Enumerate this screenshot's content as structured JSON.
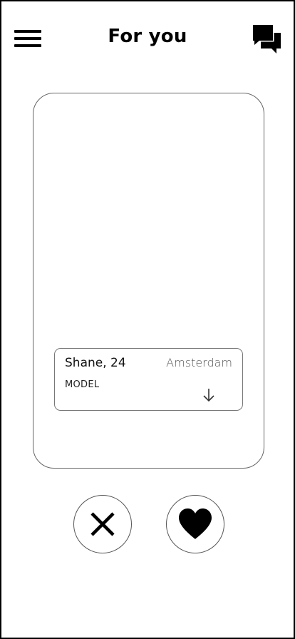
{
  "header": {
    "title": "For you",
    "menu_icon": "hamburger-menu-icon",
    "chat_icon": "chat-bubbles-icon"
  },
  "profile": {
    "name_age": "Shane, 24",
    "location": "Amsterdam",
    "occupation": "MODEL",
    "expand_icon": "arrow-down-icon"
  },
  "actions": {
    "dislike_icon": "close-icon",
    "like_icon": "heart-icon"
  },
  "colors": {
    "foreground": "#000000",
    "border": "#666666",
    "background": "#ffffff"
  }
}
